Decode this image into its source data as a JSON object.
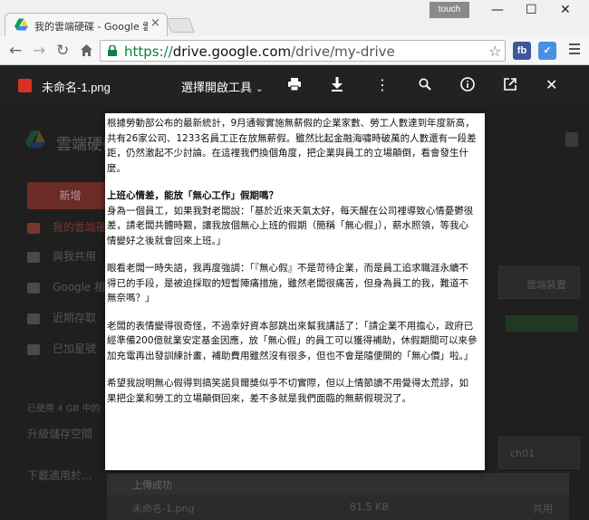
{
  "browser": {
    "tab_title": "我的雲端硬碟 - Google 雲",
    "tab_close": "×",
    "touch_label": "touch",
    "url_scheme": "https://",
    "url_host": "drive.google.com",
    "url_path": "/drive/my-drive",
    "ext1_label": "fb",
    "ext2_label": "✓",
    "colors": {
      "url_green": "#0b8043",
      "ext1": "#3b5998",
      "ext2": "#4a90e2"
    }
  },
  "viewer": {
    "file_name": "未命名-1.png",
    "open_with": "選擇開啟工具",
    "icons": [
      "print-icon",
      "download-icon",
      "more-icon",
      "zoom-icon",
      "info-icon",
      "open-external-icon",
      "close-icon"
    ]
  },
  "drive": {
    "title": "雲端硬碟",
    "new_button": "新增",
    "sidebar": [
      {
        "label": "我的雲端硬碟"
      },
      {
        "label": "與我共用"
      },
      {
        "label": "Google 相簿"
      },
      {
        "label": "近期存取"
      },
      {
        "label": "已加星號"
      }
    ],
    "storage": "已使用 4 GB 中的",
    "upgrade": "升級儲存空間",
    "backup": "下載適用於...",
    "right_card": "雲端裝置",
    "right_card2": "ch01",
    "upload": {
      "header": "上傳成功",
      "file": "未命名-1.png",
      "size": "81.5 KB",
      "share": "共用"
    }
  },
  "document": {
    "paragraphs": [
      {
        "text": "根據勞動部公布的最新統計，9月通報實施無薪假的企業家數、勞工人數達到年度新高，共有26家公司、1233名員工正在放無薪假。雖然比起金融海嘯時破萬的人數還有一段差距，仍然激起不少討論。在這裡我們換個角度，把企業與員工的立場顛倒，看會發生什麼。",
        "bold": false
      },
      {
        "text": "上班心情差，能放「無心工作」假期嗎？",
        "bold": true
      },
      {
        "text": "身為一個員工，如果我對老闆說：「基於近來天氣太好，每天醒在公司裡導致心情憂鬱很差，請老闆共體時艱，讓我放個無心上班的假期（簡稱「無心假」），薪水照領，等我心情變好之後就會回來上班。」",
        "bold": false
      },
      {
        "text": "眼看老闆一時失語，我再度強調：「『無心假』不是苛待企業，而是員工追求職涯永續不得已的手段，是被迫採取的短暫陣痛措施，雖然老闆很痛苦，但身為員工的我，難道不無奈嗎？」",
        "bold": false
      },
      {
        "text": "老闆的表情變得很奇怪，不過幸好資本部跳出來幫我講話了：「請企業不用擔心，政府已經準備200億就業安定基金因應，放「無心假」的員工可以獲得補助，休假期間可以來參加充電再出發訓練計畫，補助費用雖然沒有很多，但也不會是隨便開的「無心價」啦。」",
        "bold": false
      },
      {
        "text": "希望我說明無心假得到搞笑諾貝爾獎似乎不切實際，但以上情節讀不用覺得太荒謬，如果把企業和勞工的立場顛倒回來，差不多就是我們面臨的無薪假現況了。",
        "bold": false
      }
    ]
  }
}
